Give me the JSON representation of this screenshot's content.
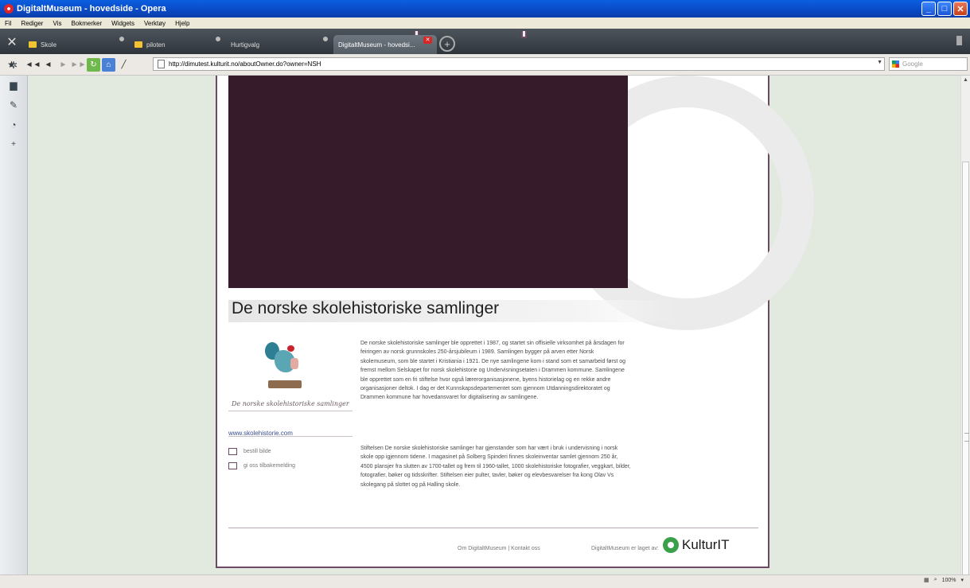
{
  "window": {
    "title": "DigitaltMuseum - hovedside - Opera",
    "buttons": {
      "minimize": "_",
      "maximize": "□",
      "close": "✕"
    }
  },
  "menu": [
    "Fil",
    "Rediger",
    "Vis",
    "Bokmerker",
    "Widgets",
    "Verktøy",
    "Hjelp"
  ],
  "tabs": [
    {
      "label": "Skole",
      "type": "folder",
      "active": false
    },
    {
      "label": "piloten",
      "type": "folder",
      "active": false
    },
    {
      "label": "Hurtigvalg",
      "type": "page",
      "active": false
    },
    {
      "label": "DigitaltMuseum - hovedsi...",
      "type": "page",
      "active": true
    }
  ],
  "toolbar": {
    "url": "http://dimutest.kulturit.no/aboutOwner.do?owner=NSH",
    "search_placeholder": "Google"
  },
  "sidepanel": {
    "icons": [
      "bookmarks-icon",
      "settings-icon",
      "windows-icon",
      "notes-icon",
      "history-icon",
      "add-panel-icon"
    ]
  },
  "page": {
    "heading": "De norske skolehistoriske samlinger",
    "logo_script": "De norske skolehistoriske samlinger",
    "site_link": "www.skolehistorie.com",
    "actions": {
      "order_image": "bestill bilde",
      "feedback": "gi oss tilbakemelding"
    },
    "paragraph1": "De norske skolehistoriske samlinger ble opprettet i 1987, og startet sin offisielle virksomhet på årsdagen for feiringen av norsk grunnskoles 250-årsjubileum i 1989. Samlingen bygger på arven etter Norsk skolemuseum, som ble startet i Kristiania i 1921. De nye samlingene kom i stand som et samarbeid først og fremst mellom Selskapet for norsk skolehistorie og Undervisningsetaten i Drammen kommune. Samlingene ble opprettet som en fri stiftelse hvor også lærerorganisasjonene, byens historielag og en rekke andre organisasjoner deltok. I dag er det Kunnskapsdepartementet som gjennom Utdanningsdirektoratet og Drammen kommune har hovedansvaret for digitalisering av samlingene.",
    "paragraph2": "Stiftelsen De norske skolehistoriske samlinger har gjenstander som har vært i bruk i undervisning i norsk skole opp igjennom tidene. I magasinet på Solberg Spinderi finnes skoleinventar samlet gjennom 250 år, 4500 plansjer fra slutten av 1700-tallet og frem til 1960-tallet, 1000 skolehistoriske fotografier, veggkart, bilder, fotografier, bøker og tidsskrifter. Stiftelsen eier pulter, tavler, bøker og elevbesvarelser fra kong Olav Vs skolegang på slottet og på Halling skole.",
    "footer": {
      "links": "Om DigitaltMuseum | Kontakt oss",
      "made_by": "DigitaltMuseum er laget av:",
      "brand": "KulturIT"
    }
  },
  "statusbar": {
    "zoom": "100%"
  },
  "colors": {
    "banner": "#361b2b",
    "frame": "#6d4a63",
    "content_bg": "#e2e9df",
    "kultur_green": "#3aa14a"
  }
}
